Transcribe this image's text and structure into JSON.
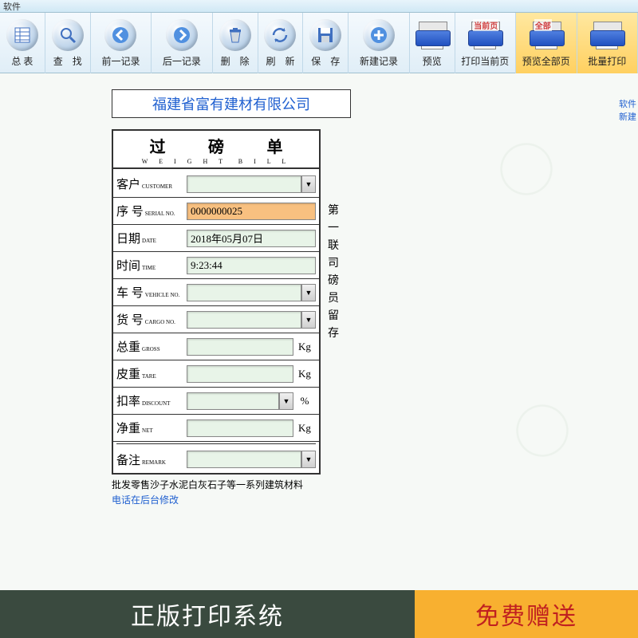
{
  "titlebar": "软件",
  "toolbar": [
    {
      "label": "总 表",
      "icon": "list"
    },
    {
      "label": "查　找",
      "icon": "search"
    },
    {
      "label": "前一记录",
      "icon": "prev"
    },
    {
      "label": "后一记录",
      "icon": "next"
    },
    {
      "label": "删　除",
      "icon": "trash"
    },
    {
      "label": "刷　新",
      "icon": "refresh"
    },
    {
      "label": "保　存",
      "icon": "save"
    },
    {
      "label": "新建记录",
      "icon": "new"
    },
    {
      "label": "预览",
      "icon": "preview",
      "printer": true,
      "tag": ""
    },
    {
      "label": "打印当前页",
      "icon": "print",
      "printer": true,
      "tag": "当前页"
    },
    {
      "label": "预览全部页",
      "icon": "previewall",
      "printer": true,
      "tag": "全部",
      "red": true
    },
    {
      "label": "批量打印",
      "icon": "batchprint",
      "printer": true,
      "tag": "",
      "red": true
    }
  ],
  "sidelinks": [
    "软件",
    "新建"
  ],
  "company": "福建省富有建材有限公司",
  "form": {
    "title_cn": "过 磅 单",
    "title_en": "W E I G H T　B I L L",
    "rows": [
      {
        "cn": "客户",
        "en": "CUSTOMER",
        "type": "select",
        "value": ""
      },
      {
        "cn": "序 号",
        "en": "SERIAL NO.",
        "type": "text",
        "value": "0000000025",
        "orange": true
      },
      {
        "cn": "日期",
        "en": "DATE",
        "type": "text",
        "value": "2018年05月07日"
      },
      {
        "cn": "时间",
        "en": "TIME",
        "type": "text",
        "value": "9:23:44"
      },
      {
        "cn": "车 号",
        "en": "VEHICLE NO.",
        "type": "select",
        "value": ""
      },
      {
        "cn": "货 号",
        "en": "CARGO NO.",
        "type": "select",
        "value": ""
      },
      {
        "cn": "总重",
        "en": "GROSS",
        "type": "text",
        "value": "",
        "unit": "Kg"
      },
      {
        "cn": "皮重",
        "en": "TARE",
        "type": "text",
        "value": "",
        "unit": "Kg"
      },
      {
        "cn": "扣率",
        "en": "DISCOUNT",
        "type": "select",
        "value": "",
        "unit": "%"
      },
      {
        "cn": "净重",
        "en": "NET",
        "type": "text",
        "value": "",
        "unit": "Kg"
      },
      {
        "cn": "备注",
        "en": "REMARK",
        "type": "select",
        "value": "",
        "sep": true
      }
    ],
    "side_text": "第一联　司磅员留存",
    "footer1": "批发零售沙子水泥白灰石子等一系列建筑材料",
    "footer2": "电话在后台修改"
  },
  "banner": {
    "left": "正版打印系统",
    "right": "免费赠送"
  }
}
